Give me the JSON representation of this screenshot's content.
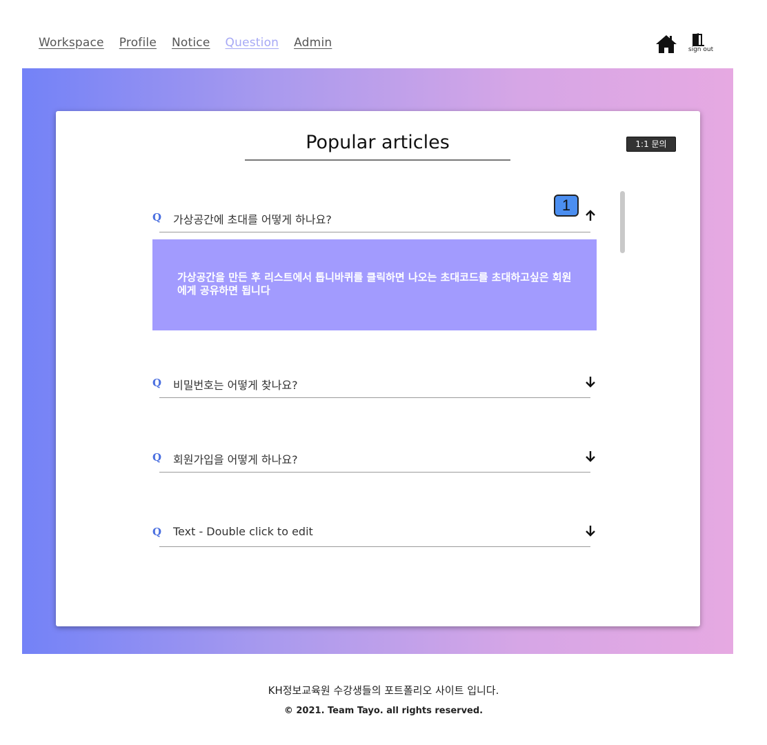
{
  "nav": {
    "links": [
      {
        "label": "Workspace"
      },
      {
        "label": "Profile"
      },
      {
        "label": "Notice"
      },
      {
        "label": "Question"
      },
      {
        "label": "Admin"
      }
    ],
    "active_link": "Question",
    "signout_label": "sign out",
    "home_icon": "home-icon",
    "signout_icon": "door-icon"
  },
  "card": {
    "title": "Popular articles",
    "inquiry_button": "1:1 문의",
    "badge": "1"
  },
  "faq": {
    "q_marker": "Q",
    "items": [
      {
        "question": "가상공간에 초대를 어떻게 하나요?",
        "expanded": true,
        "answer": "가상공간을 만든 후 리스트에서 톱니바퀴를 클릭하면 나오는 초대코드를 초대하고싶은 회원에게 공유하면 됩니다"
      },
      {
        "question": "비밀번호는 어떻게 찾나요?",
        "expanded": false
      },
      {
        "question": "회원가입을 어떻게 하나요?",
        "expanded": false
      },
      {
        "question": "Text - Double click to edit",
        "expanded": false
      }
    ]
  },
  "footer": {
    "line1": "KH정보교육원 수강생들의 포트폴리오 사이트 입니다.",
    "line2": "© 2021. Team Tayo. all rights reserved."
  },
  "colors": {
    "accent": "#a29bfe",
    "q_icon": "#4a6fe0",
    "gradient_start": "#7382f7",
    "gradient_end": "#e6a9e2",
    "active_nav": "#a6a8f5",
    "badge": "#4b8ef0"
  }
}
